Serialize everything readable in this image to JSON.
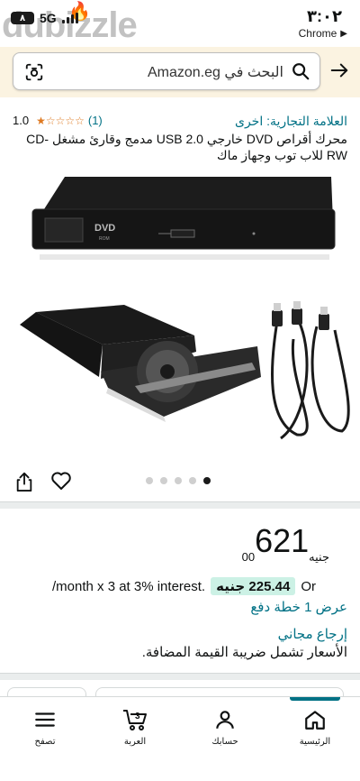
{
  "status_bar": {
    "battery": "٨",
    "network": "5G",
    "watermark": "dubizzle",
    "time": "٣:٠٢",
    "app_back_label": "Chrome"
  },
  "search": {
    "placeholder": "البحث في Amazon.eg"
  },
  "product": {
    "brand": "العلامة التجارية: اخرى",
    "rating_value": "1.0",
    "rating_stars": 1,
    "rating_count": "(1)",
    "title": "محرك أقراص DVD خارجي USB 2.0 مدمج وقارئ مشغل CD-RW للاب توب وجهاز ماك",
    "image_label_dvd": "DVD",
    "image_label_rom": "ROM",
    "carousel_total": 5,
    "carousel_active": 5
  },
  "price": {
    "main": "621",
    "fraction": "00",
    "currency": "جنيه"
  },
  "installment": {
    "or": "Or",
    "amount": "225.44 جنيه",
    "terms": "/month x 3 at 3% interest."
  },
  "links": {
    "payment_plan": "عرض 1 خطة دفع",
    "free_returns": "إرجاع مجاني",
    "vat_note": "الأسعار تشمل ضريبة القيمة المضافة."
  },
  "tabbar": {
    "home": "الرئيسية",
    "account": "حسابك",
    "cart": "العربة",
    "cart_count": "3",
    "browse": "تصفح"
  },
  "colors": {
    "link": "#007185",
    "star": "#de7921",
    "header_bg": "#fbf3e1",
    "installment_bg": "#ccf1e5"
  }
}
